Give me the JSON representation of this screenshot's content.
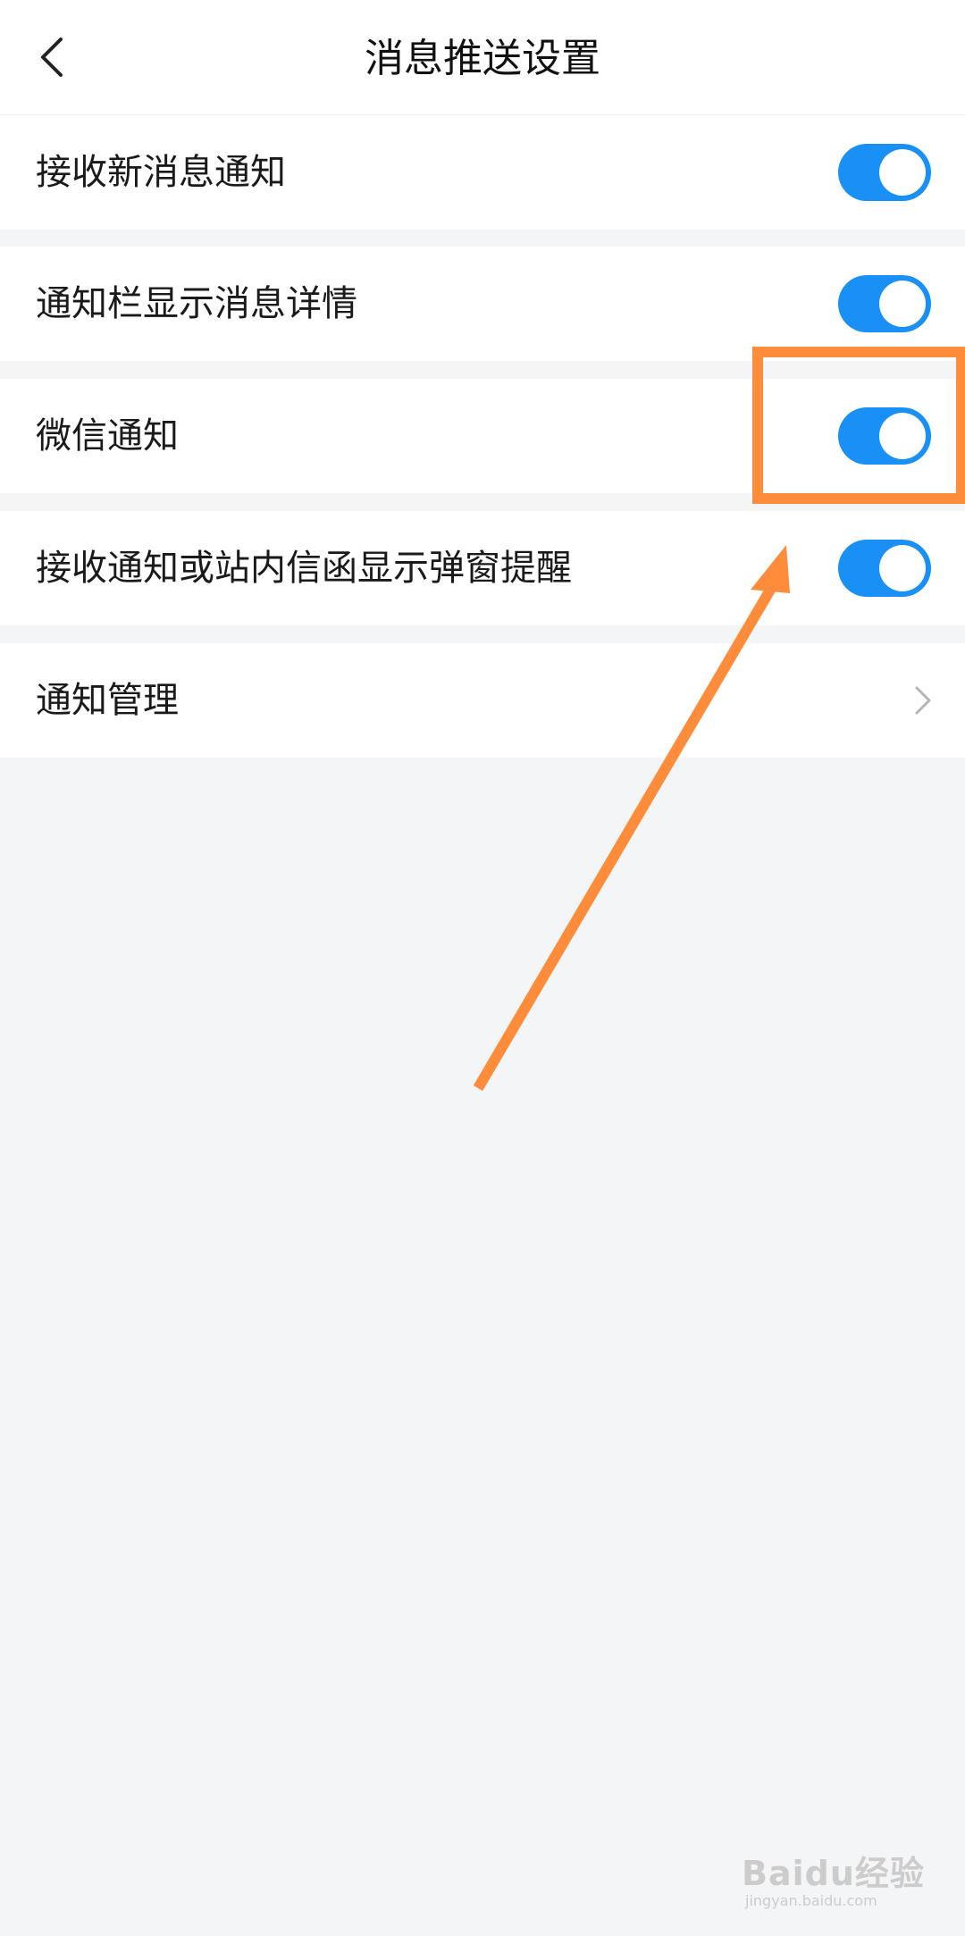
{
  "header": {
    "title": "消息推送设置",
    "back_icon": "chevron-left-icon"
  },
  "settings": [
    {
      "label": "接收新消息通知",
      "control": "toggle",
      "enabled": true
    },
    {
      "label": "通知栏显示消息详情",
      "control": "toggle",
      "enabled": true
    },
    {
      "label": "微信通知",
      "control": "toggle",
      "enabled": true
    },
    {
      "label": "接收通知或站内信函显示弹窗提醒",
      "control": "toggle",
      "enabled": true
    },
    {
      "label": "通知管理",
      "control": "chevron",
      "icon": "chevron-right-icon"
    }
  ],
  "colors": {
    "toggle_on": "#1890f5",
    "background": "#f4f5f7",
    "annotation": "#ff8c3a"
  },
  "watermark": {
    "text": "Baidu经验",
    "sub": "jingyan.baidu.com"
  }
}
